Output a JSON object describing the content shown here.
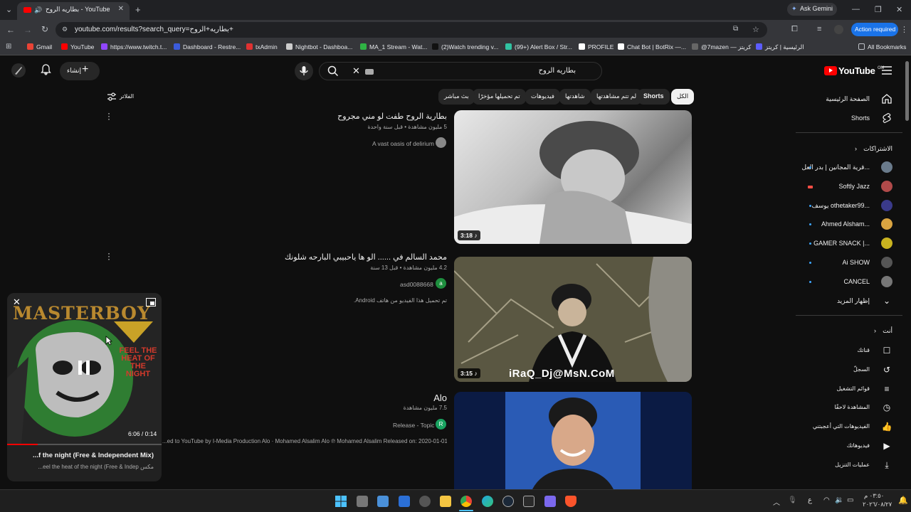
{
  "browser": {
    "tab_title": "YouTube - بطاريه الروح",
    "url": "youtube.com/results?search_query=بطاريه+الروح+",
    "ask_gemini": "Ask Gemini",
    "action_required": "Action required",
    "all_bookmarks": "All Bookmarks",
    "bookmarks": [
      {
        "label": "Gmail",
        "color": "#ea4335"
      },
      {
        "label": "YouTube",
        "color": "#ff0000"
      },
      {
        "label": "https://www.twitch.t...",
        "color": "#9146ff"
      },
      {
        "label": "Dashboard - Restre...",
        "color": "#3b5bdb"
      },
      {
        "label": "txAdmin",
        "color": "#e03131"
      },
      {
        "label": "Nightbot - Dashboa...",
        "color": "#cccccc"
      },
      {
        "label": "MA_1 Stream - Wat...",
        "color": "#2fb344"
      },
      {
        "label": "(2)Watch trending v...",
        "color": "#111111"
      },
      {
        "label": "(99+) Alert Box / Str...",
        "color": "#31c3a2"
      },
      {
        "label": "PROFILE",
        "color": "#ffffff"
      },
      {
        "label": "Chat Bot | BotRix —...",
        "color": "#ffffff"
      },
      {
        "label": "@7mazen — كريتز",
        "color": "#666666"
      },
      {
        "label": "الرئيسية | كريتز",
        "color": "#5c5cff"
      }
    ]
  },
  "header": {
    "search_query": "بطاريه الروح",
    "create_label": "إنشاء",
    "logo_text": "YouTube",
    "logo_country": "OM"
  },
  "filters": {
    "label": "الفلاتر",
    "chips": [
      "الكل",
      "Shorts",
      "لم تتم مشاهدتها",
      "شاهدتها",
      "فيديوهات",
      "تم تحميلها مؤخرًا",
      "بث مباشر"
    ]
  },
  "results": [
    {
      "title": "بطارية الروح طفت لو مني مجروح",
      "meta": "5 مليون مشاهدة • قبل سنة واحدة",
      "channel": "A vast oasis of delirium",
      "duration": "3:18",
      "description": ""
    },
    {
      "title": "محمد السالم في ...... الو ها ياحبيبي البارحه شلونك",
      "meta": "4.2 مليون مشاهدة • قبل 13 سنة",
      "channel": "asd0088668",
      "channel_initial": "a",
      "duration": "3:15",
      "watermark": "iRaQ_Dj@MsN.CoM",
      "description": "تم تحميل هذا الفيديو من هاتف Android."
    },
    {
      "title": "Alo",
      "meta": "7.5 مليون مشاهدة",
      "channel": "Release - Topic",
      "channel_initial": "R",
      "duration": "",
      "description": "...ed to YouTube by I-Media Production Alo · Mohamed Alsalim Alo ℗ Mohamed Alsalim Released on: 2020-01-01"
    }
  ],
  "sidebar": {
    "home": "الصفحة الرئيسية",
    "shorts": "Shorts",
    "subscriptions_header": "الاشتراكات",
    "subscriptions": [
      {
        "name": "قرية المجانين | بدر العل...",
        "color": "#6a7b8c"
      },
      {
        "name": "Softly Jazz",
        "color": "#b04a4a"
      },
      {
        "name": "يوسف othetaker99...",
        "color": "#3a3a8a"
      },
      {
        "name": "Ahmed Alsham...",
        "color": "#d9a441"
      },
      {
        "name": "GAMER SNACK |...",
        "color": "#c9b320"
      },
      {
        "name": "Ai SHOW",
        "color": "#555555"
      },
      {
        "name": "CANCEL",
        "color": "#777777"
      }
    ],
    "show_more": "إظهار المزيد",
    "you_header": "أنت",
    "you_items": [
      "قناتك",
      "السجلّ",
      "قوائم التشغيل",
      "المشاهدة لاحقًا",
      "الفيديوهات التي أعجبتني",
      "فيديوهاتك",
      "عمليات التنزيل"
    ]
  },
  "miniplayer": {
    "art_title": "MASTERBOY",
    "art_subtitle": "FEEL THE HEAT OF THE NIGHT",
    "time": "6:06 / 0:14",
    "progress": 0.2,
    "title": "...f the night (Free & Independent Mix)",
    "subtitle": "...eel the heat of the night (Free & Indep مكس"
  },
  "taskbar": {
    "clock_time": "٠٣:٥٠ م",
    "clock_date": "٢٠٢٦/٠٨/٢٧",
    "lang": "ع"
  }
}
